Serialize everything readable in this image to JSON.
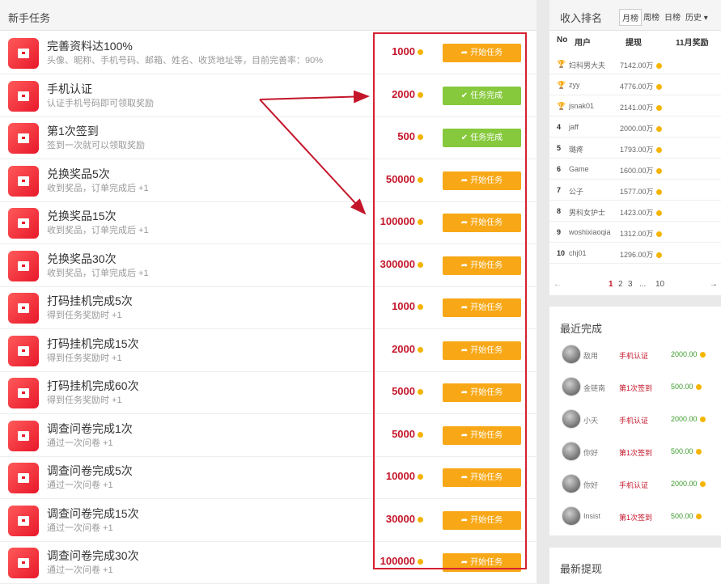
{
  "left": {
    "title": "新手任务",
    "tasks": [
      {
        "title": "完善资料达100%",
        "desc": "头像、昵称、手机号码、邮箱、姓名、收货地址等，目前完善率：90%",
        "reward": "1000",
        "btn": "开始任务",
        "done": false
      },
      {
        "title": "手机认证",
        "desc": "认证手机号码即可领取奖励",
        "reward": "2000",
        "btn": "任务完成",
        "done": true
      },
      {
        "title": "第1次签到",
        "desc": "签到一次就可以领取奖励",
        "reward": "500",
        "btn": "任务完成",
        "done": true
      },
      {
        "title": "兑换奖品5次",
        "desc": "收到奖品，订单完成后 +1",
        "reward": "50000",
        "btn": "开始任务",
        "done": false
      },
      {
        "title": "兑换奖品15次",
        "desc": "收到奖品，订单完成后 +1",
        "reward": "100000",
        "btn": "开始任务",
        "done": false
      },
      {
        "title": "兑换奖品30次",
        "desc": "收到奖品，订单完成后 +1",
        "reward": "300000",
        "btn": "开始任务",
        "done": false
      },
      {
        "title": "打码挂机完成5次",
        "desc": "得到任务奖励时 +1",
        "reward": "1000",
        "btn": "开始任务",
        "done": false
      },
      {
        "title": "打码挂机完成15次",
        "desc": "得到任务奖励时 +1",
        "reward": "2000",
        "btn": "开始任务",
        "done": false
      },
      {
        "title": "打码挂机完成60次",
        "desc": "得到任务奖励时 +1",
        "reward": "5000",
        "btn": "开始任务",
        "done": false
      },
      {
        "title": "调查问卷完成1次",
        "desc": "通过一次问卷 +1",
        "reward": "5000",
        "btn": "开始任务",
        "done": false
      },
      {
        "title": "调查问卷完成5次",
        "desc": "通过一次问卷 +1",
        "reward": "10000",
        "btn": "开始任务",
        "done": false
      },
      {
        "title": "调查问卷完成15次",
        "desc": "通过一次问卷 +1",
        "reward": "30000",
        "btn": "开始任务",
        "done": false
      },
      {
        "title": "调查问卷完成30次",
        "desc": "通过一次问卷 +1",
        "reward": "100000",
        "btn": "开始任务",
        "done": false
      }
    ]
  },
  "rank": {
    "title": "收入排名",
    "tabs": [
      "月榜",
      "周榜",
      "日榜",
      "历史"
    ],
    "cols": {
      "no": "No",
      "user": "用户",
      "amount": "提现",
      "prize": "11月奖励"
    },
    "rows": [
      {
        "no": "",
        "user": "妇科男大夫",
        "amount": "7142.00万"
      },
      {
        "no": "",
        "user": "zyy",
        "amount": "4776.00万"
      },
      {
        "no": "",
        "user": "jsnak01",
        "amount": "2141.00万"
      },
      {
        "no": "4",
        "user": "jaff",
        "amount": "2000.00万"
      },
      {
        "no": "5",
        "user": "璐疼",
        "amount": "1793.00万"
      },
      {
        "no": "6",
        "user": "Game",
        "amount": "1600.00万"
      },
      {
        "no": "7",
        "user": "公子",
        "amount": "1577.00万"
      },
      {
        "no": "8",
        "user": "男科女护士",
        "amount": "1423.00万"
      },
      {
        "no": "9",
        "user": "woshixiaoqia",
        "amount": "1312.00万"
      },
      {
        "no": "10",
        "user": "chj01",
        "amount": "1296.00万"
      }
    ],
    "pager": {
      "prev": "←",
      "pages": [
        "1",
        "2",
        "3",
        "...",
        "10"
      ],
      "next": "→"
    }
  },
  "recent": {
    "title": "最近完成",
    "rows": [
      {
        "name": "敌用",
        "task": "手机认证",
        "amount": "2000.00"
      },
      {
        "name": "金链南",
        "task": "第1次签到",
        "amount": "500.00"
      },
      {
        "name": "小天",
        "task": "手机认证",
        "amount": "2000.00"
      },
      {
        "name": "你好",
        "task": "第1次签到",
        "amount": "500.00"
      },
      {
        "name": "你好",
        "task": "手机认证",
        "amount": "2000.00"
      },
      {
        "name": "Insist",
        "task": "第1次签到",
        "amount": "500.00"
      }
    ]
  },
  "withdraw": {
    "title": "最新提现"
  },
  "colors": {
    "accent": "#c4162a",
    "start_btn": "#f8a816",
    "done_btn": "#86c93c",
    "box": "#d62232"
  }
}
